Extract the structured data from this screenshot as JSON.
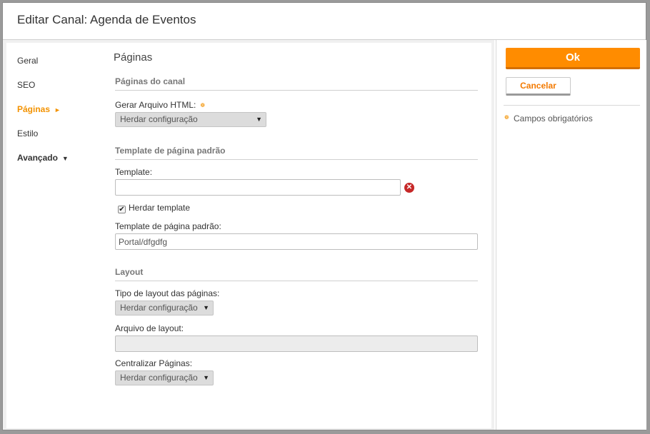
{
  "dialog": {
    "title": "Editar Canal: Agenda de Eventos"
  },
  "nav": {
    "items": [
      {
        "label": "Geral"
      },
      {
        "label": "SEO"
      },
      {
        "label": "Páginas",
        "marker": "►"
      },
      {
        "label": "Estilo"
      },
      {
        "label": "Avançado",
        "marker": "▼"
      }
    ]
  },
  "main": {
    "title": "Páginas",
    "group_pages": {
      "title": "Páginas do canal",
      "html_label": "Gerar Arquivo HTML:",
      "html_select": "Herdar configuração"
    },
    "group_template": {
      "title": "Template de página padrão",
      "template_label": "Template:",
      "template_value": "",
      "inherit_label": "Herdar template",
      "default_label": "Template de página padrão:",
      "default_value": "Portal/dfgdfg"
    },
    "group_layout": {
      "title": "Layout",
      "type_label": "Tipo de layout das páginas:",
      "type_select": "Herdar configuração",
      "file_label": "Arquivo de layout:",
      "file_value": "",
      "center_label": "Centralizar Páginas:",
      "center_select": "Herdar configuração"
    }
  },
  "actions": {
    "ok_label": "Ok",
    "cancel_label": "Cancelar",
    "required_note": "Campos obrigatórios"
  },
  "glyphs": {
    "caret": "▼",
    "required": "❁",
    "check": "✔",
    "clear": "✕"
  },
  "colors": {
    "accent": "#ff8c00",
    "accent_text": "#f39200",
    "clear": "#c62828"
  }
}
